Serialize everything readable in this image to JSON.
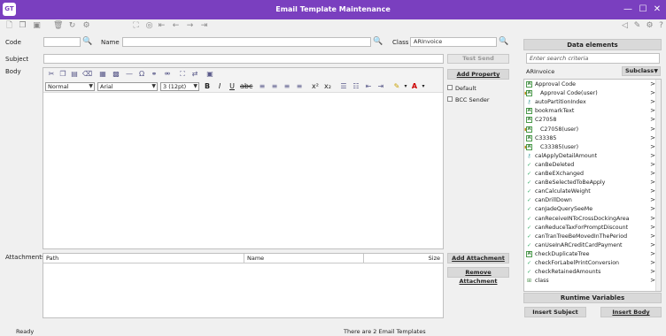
{
  "window": {
    "logo": "GT",
    "title": "Email Template Maintenance",
    "controls": {
      "minimize": "—",
      "maximize": "☐",
      "close": "✕"
    }
  },
  "toolbar": {
    "icons": [
      "new-doc-icon",
      "copy-doc-icon",
      "save-icon",
      "delete-icon",
      "refresh-icon",
      "workflow-icon",
      "binoculars-icon",
      "compass-icon",
      "first-icon",
      "prev-icon",
      "next-icon",
      "last-icon"
    ],
    "right_icons": [
      "filter-icon",
      "graph-icon",
      "help-icon"
    ]
  },
  "form": {
    "code_label": "Code",
    "code_value": "",
    "name_label": "Name",
    "name_value": "",
    "class_label": "Class",
    "class_value": "ARInvoice",
    "subject_label": "Subject",
    "subject_value": "",
    "body_label": "Body",
    "attachments_label": "Attachments"
  },
  "buttons": {
    "test_send": "Test Send",
    "add_property": "Add Property",
    "add_attachment": "Add Attachment",
    "remove_attachment": "Remove Attachment",
    "insert_subject": "Insert Subject",
    "insert_body": "Insert Body"
  },
  "checkboxes": {
    "default": {
      "label": "Default",
      "checked": false
    },
    "bcc_sender": {
      "label": "BCC Sender",
      "checked": false
    }
  },
  "editor": {
    "style": "Normal",
    "font": "Arial",
    "size": "3 (12pt)"
  },
  "attachments_grid": {
    "columns": [
      "Path",
      "Name",
      "Size"
    ],
    "rows": []
  },
  "data_elements": {
    "header": "Data elements",
    "search_placeholder": "Enter search criteria",
    "class_name": "ARInvoice",
    "subclass_label": "Subclass",
    "items": [
      {
        "icon": "attr-icon",
        "label": "Approval Code"
      },
      {
        "icon": "attr-icon",
        "label": "Approval Code(user)",
        "user": true
      },
      {
        "icon": "key-icon",
        "label": "autoPartitionIndex"
      },
      {
        "icon": "attr-icon",
        "label": "bookmarkText"
      },
      {
        "icon": "attr-icon",
        "label": "C27058"
      },
      {
        "icon": "attr-icon",
        "label": "C27058(user)",
        "user": true
      },
      {
        "icon": "attr-icon",
        "label": "C33385"
      },
      {
        "icon": "attr-icon",
        "label": "C33385(user)",
        "user": true
      },
      {
        "icon": "key-icon",
        "label": "calApplyDetailAmount"
      },
      {
        "icon": "check-icon",
        "label": "canBeDeleted"
      },
      {
        "icon": "check-icon",
        "label": "canBeEXchanged"
      },
      {
        "icon": "check-icon",
        "label": "canBeSelectedToBeApply"
      },
      {
        "icon": "check-icon",
        "label": "canCalculateWeight"
      },
      {
        "icon": "check-icon",
        "label": "canDrillDown"
      },
      {
        "icon": "check-icon",
        "label": "canJadeQuerySeeMe"
      },
      {
        "icon": "check-icon",
        "label": "canReceiveINToCrossDockingArea"
      },
      {
        "icon": "check-icon",
        "label": "canReduceTaxForPromptDiscount"
      },
      {
        "icon": "check-icon",
        "label": "canTranTreeBeMovedInThePeriod"
      },
      {
        "icon": "check-icon",
        "label": "canUseInARCreditCardPayment"
      },
      {
        "icon": "attr-icon",
        "label": "checkDuplicateTree"
      },
      {
        "icon": "check-icon",
        "label": "checkForLabelPrintConversion"
      },
      {
        "icon": "check-icon",
        "label": "checkRetainedAmounts"
      },
      {
        "icon": "class-icon",
        "label": "class"
      }
    ],
    "runtime_header": "Runtime Variables"
  },
  "status": {
    "left": "Ready",
    "center": "There are 2 Email Templates"
  },
  "colors": {
    "titlebar": "#7a3fbf",
    "panel": "#f0f0f0",
    "button": "#d9d9d9"
  }
}
